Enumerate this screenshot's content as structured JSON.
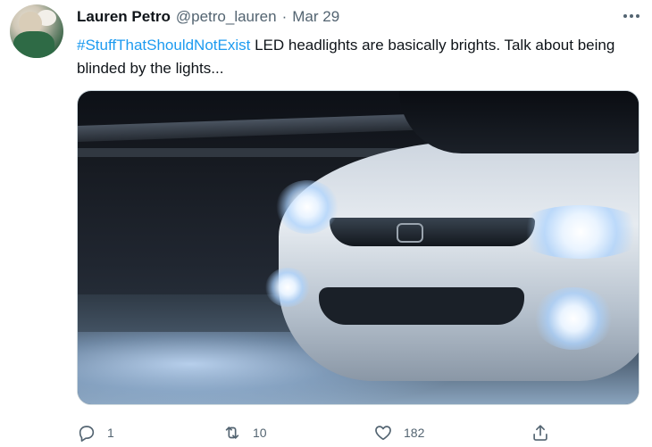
{
  "tweet": {
    "author_name": "Lauren Petro",
    "author_handle": "@petro_lauren",
    "separator": "·",
    "date": "Mar 29",
    "hashtag": "#StuffThatShouldNotExist",
    "text": " LED headlights are basically brights. Talk about being blinded by the lights..."
  },
  "media": {
    "icon": "photo-of-car-headlights"
  },
  "actions": {
    "reply_count": "1",
    "retweet_count": "10",
    "like_count": "182",
    "share_count": ""
  },
  "icons": [
    "more-options-icon",
    "reply-icon",
    "retweet-icon",
    "like-icon",
    "share-icon"
  ],
  "colors": {
    "link": "#1d9bf0",
    "secondary_text": "#536471",
    "primary_text": "#0f1419"
  }
}
